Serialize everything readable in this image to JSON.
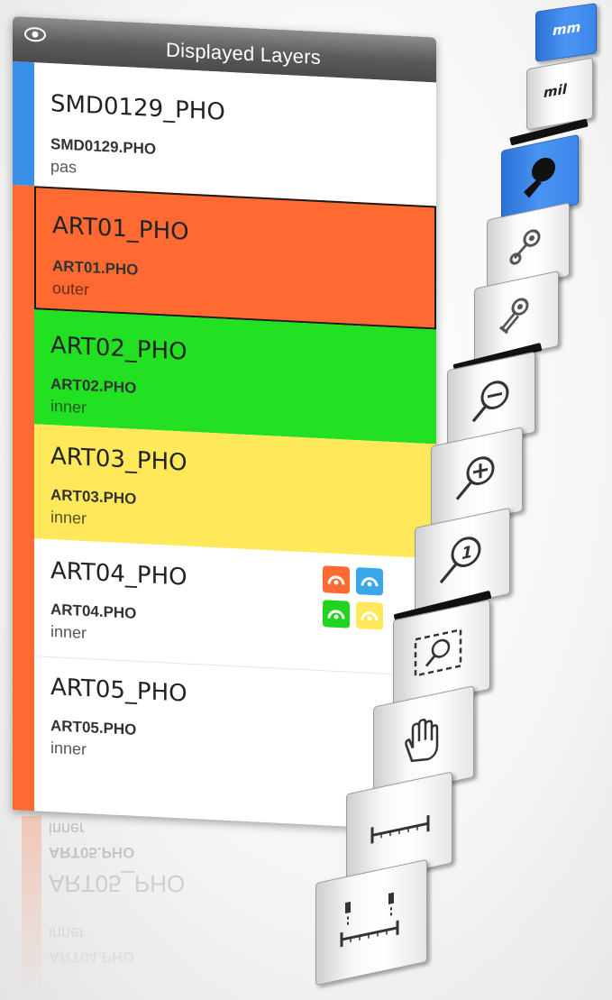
{
  "panel": {
    "title": "Displayed Layers",
    "layers": [
      {
        "name": "SMD0129_PHO",
        "file": "SMD0129.PHO",
        "type": "pas",
        "color": "#ffffff"
      },
      {
        "name": "ART01_PHO",
        "file": "ART01.PHO",
        "type": "outer",
        "color": "#ff6a33"
      },
      {
        "name": "ART02_PHO",
        "file": "ART02.PHO",
        "type": "inner",
        "color": "#22e022"
      },
      {
        "name": "ART03_PHO",
        "file": "ART03.PHO",
        "type": "inner",
        "color": "#ffe85a"
      },
      {
        "name": "ART04_PHO",
        "file": "ART04.PHO",
        "type": "inner",
        "color": "#ffffff"
      },
      {
        "name": "ART05_PHO",
        "file": "ART05.PHO",
        "type": "inner",
        "color": "#ffffff"
      }
    ],
    "color_swatches": [
      "#ff6a33",
      "#3aa8e8",
      "#22d422",
      "#ffe85a"
    ],
    "stripe_colors": {
      "top": "#3a8fe6",
      "rest": "#ff6a33"
    }
  },
  "reflection": {
    "lines": [
      "inner",
      "ART05.PHO",
      "ART05_PHO",
      "inner",
      "ART04.PHO"
    ]
  },
  "toolbar": {
    "unit_mm": "mm",
    "unit_mil": "mil",
    "tools": [
      "select-cursor-icon",
      "net-highlight-icon",
      "net-trace-icon",
      "zoom-out-icon",
      "zoom-in-icon",
      "zoom-actual-icon",
      "zoom-area-icon",
      "pan-hand-icon",
      "measure-ruler-icon",
      "measure-distance-icon"
    ],
    "active_color": "#3a8fe6"
  }
}
